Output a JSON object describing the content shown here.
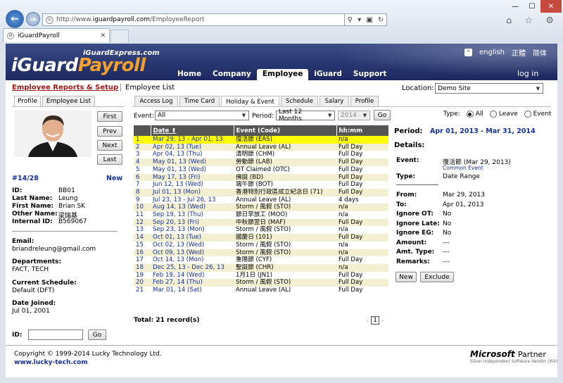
{
  "browser": {
    "url_prefix": "http://www.",
    "url_host": "iguardpayroll.com",
    "url_path": "/EmployeeReport",
    "tab_title": "iGuardPayroll"
  },
  "header": {
    "brand_sub": "iGuardExpress.com",
    "brand_a": "iGuard",
    "brand_b": "Payroll",
    "lang": [
      "english",
      "正體",
      "简体"
    ],
    "nav": [
      "Home",
      "Company",
      "Employee",
      "iGuard",
      "Support"
    ],
    "logout": "log in"
  },
  "subheader": {
    "crumb_main": "Employee Reports & Setup",
    "crumb_sub": "Employee List",
    "location_label": "Location:",
    "location_value": "Demo Site"
  },
  "left": {
    "tabs": [
      "Profile",
      "Employee List"
    ],
    "buttons": [
      "First",
      "Prev",
      "Next",
      "Last"
    ],
    "counter": "#14/28",
    "new": "New",
    "fields": [
      {
        "k": "ID:",
        "v": "BB01"
      },
      {
        "k": "Last Name:",
        "v": "Leung"
      },
      {
        "k": "First Name:",
        "v": "Brian SK"
      },
      {
        "k": "Other Name:",
        "v": "梁瑞基"
      },
      {
        "k": "Internal ID:",
        "v": "B569067"
      }
    ],
    "email_label": "Email:",
    "email": "briandreleung@gmail.com",
    "dept_label": "Departments:",
    "dept": "FACT, TECH",
    "sched_label": "Current Schedule:",
    "sched": "Default (DFT)",
    "joined_label": "Date Joined:",
    "joined": "Jul 01, 2001",
    "id_label": "ID:",
    "id_go": "Go"
  },
  "right_tabs": [
    "Access Log",
    "Time Card",
    "Holiday & Event",
    "Schedule",
    "Salary",
    "Profile"
  ],
  "filter": {
    "event_label": "Event:",
    "event_value": "All",
    "period_label": "Period:",
    "period_value": "Last 12 Months",
    "year_value": "2014",
    "go": "Go",
    "type_label": "Type:",
    "type_options": [
      "All",
      "Leave",
      "Event"
    ]
  },
  "table": {
    "headers": [
      "Date",
      "Event (Code)",
      "hh:mm"
    ],
    "rows": [
      [
        "1",
        "Mar 29, 13 - Apr 01, 13",
        "復活節 (EAS)",
        "n/a"
      ],
      [
        "2",
        "Apr 02, 13 (Tue)",
        "Annual Leave (AL)",
        "Full Day"
      ],
      [
        "3",
        "Apr 04, 13 (Thu)",
        "清明節 (CHM)",
        "Full Day"
      ],
      [
        "4",
        "May 01, 13 (Wed)",
        "勞動節 (LAB)",
        "Full Day"
      ],
      [
        "5",
        "May 01, 13 (Wed)",
        "OT Claimed (OTC)",
        "Full Day"
      ],
      [
        "6",
        "May 17, 13 (Fri)",
        "佛誕 (BD)",
        "Full Day"
      ],
      [
        "7",
        "Jun 12, 13 (Wed)",
        "端午節 (BOT)",
        "Full Day"
      ],
      [
        "8",
        "Jul 01, 13 (Mon)",
        "香港特別行政區成立紀念日 (71)",
        "Full Day"
      ],
      [
        "9",
        "Jul 23, 13 - Jul 26, 13",
        "Annual Leave (AL)",
        "4 days"
      ],
      [
        "10",
        "Aug 14, 13 (Wed)",
        "Storm / 風假 (STO)",
        "n/a"
      ],
      [
        "11",
        "Sep 19, 13 (Thu)",
        "節日早放工 (MOO)",
        "n/a"
      ],
      [
        "12",
        "Sep 20, 13 (Fri)",
        "中秋節翌日 (MAF)",
        "Full Day"
      ],
      [
        "13",
        "Sep 23, 13 (Mon)",
        "Storm / 風假 (STO)",
        "n/a"
      ],
      [
        "14",
        "Oct 01, 13 (Tue)",
        "國慶日 (101)",
        "Full Day"
      ],
      [
        "15",
        "Oct 02, 13 (Wed)",
        "Storm / 風假 (STO)",
        "n/a"
      ],
      [
        "16",
        "Oct 09, 13 (Wed)",
        "Storm / 風假 (STO)",
        "n/a"
      ],
      [
        "17",
        "Oct 14, 13 (Mon)",
        "重陽節 (CYF)",
        "Full Day"
      ],
      [
        "18",
        "Dec 25, 13 - Dec 26, 13",
        "聖誕節 (CHR)",
        "n/a"
      ],
      [
        "19",
        "Feb 19, 14 (Wed)",
        "1月1日 (JN1)",
        "Full Day"
      ],
      [
        "20",
        "Feb 27, 14 (Thu)",
        "Storm / 風假 (STO)",
        "Full Day"
      ],
      [
        "21",
        "Mar 01, 14 (Sat)",
        "Annual Leave (AL)",
        "Full Day"
      ]
    ],
    "total": "Total: 21 record(s)",
    "page": "1"
  },
  "details": {
    "period_label": "Period:",
    "period_value": "Apr 01, 2013 - Mar 31, 2014",
    "details_label": "Details:",
    "event_k": "Event:",
    "event_v": "復活節  (Mar 29, 2013)",
    "common": "Common Event",
    "type_k": "Type:",
    "type_v": "Date Range",
    "rows": [
      {
        "k": "From:",
        "v": "Mar 29, 2013"
      },
      {
        "k": "To:",
        "v": "Apr 01, 2013"
      },
      {
        "k": "Ignore OT:",
        "v": "No"
      },
      {
        "k": "Ignore Late:",
        "v": "No"
      },
      {
        "k": "Ignore EG:",
        "v": "No"
      },
      {
        "k": "Amount:",
        "v": "---"
      },
      {
        "k": "Amt. Type:",
        "v": "---"
      },
      {
        "k": "Remarks:",
        "v": "---"
      }
    ],
    "btn_new": "New",
    "btn_exclude": "Exclude"
  },
  "footer": {
    "copyright": "Copyright © 1999-2014 Lucky Technology Ltd.",
    "site": "www.lucky-tech.com",
    "ms_brand": "Microsoft",
    "ms_partner": "Partner",
    "ms_sub": "Silver Independent Software Vendor (ISV)"
  }
}
